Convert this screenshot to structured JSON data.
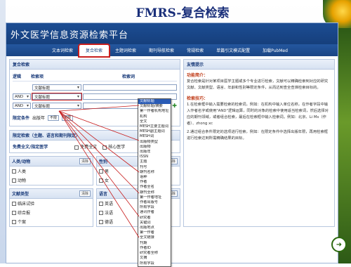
{
  "slide_title": "FMRS-复合检索",
  "app_title": "外文医学信息资源检索平台",
  "nav": [
    "文本词检索",
    "复合检索",
    "主题词检索",
    "期刊导航检索",
    "常规检索",
    "单篇引文模式配置",
    "加载PubMed"
  ],
  "left": {
    "section_title": "复合检索",
    "grid_headers": [
      "逻辑",
      "检索项",
      "检索词"
    ],
    "rows": [
      {
        "logic": "",
        "field": "文献标题"
      },
      {
        "logic": "AND",
        "field": "文献标题"
      },
      {
        "logic": "AND",
        "field": "文献标题"
      }
    ],
    "limit_label": "限定条件",
    "limit_year_label": "出版年",
    "limit_year_from": "不限",
    "limit_year_to": "不限",
    "sub_section": "限定检索（主题、语言和期刊限定）",
    "options_label": "免费全文/指定医学",
    "opt_fulltext": "免费全文",
    "opt_core": "核心医学",
    "cards_row1": [
      {
        "title": "人类/动物",
        "btn": "清除",
        "items": [
          "人类",
          "动物"
        ]
      },
      {
        "title": "性别",
        "btn": "清除",
        "items": [
          "男",
          "女"
        ]
      }
    ],
    "cards_row2": [
      {
        "title": "文献类型",
        "btn": "清除",
        "items": [
          "临床试验",
          "综合报",
          "个案"
        ]
      },
      {
        "title": "语言",
        "btn": "清除",
        "items": [
          "英语",
          "法语",
          "德语"
        ]
      }
    ]
  },
  "right": {
    "title": "友情提示",
    "h1": "功能简介：",
    "p1": "复合检索是针对某项目医学主题或多个专业进行检索，文献可以精确检索到对应的研究文献、文献类型、语言、年龄和性别等限定条件，从而达到查全查准检索目标的。",
    "h2": "检索技巧：",
    "p2": "1.在检索框中输入需要检索的检索词，例如：在机构中输入单位名称，在作者字段中输入作者名字或使用\"AND\"逻辑运算，同时的对象的检索中使用适当检索词，然后选择对应的期刊领域，或者组合检索，最后在检索框中输入检索词。例如：北京、Li Ms（作者）、zhong xc",
    "p3": "2.通过组合条件限定的选项进行检索，例如：在限定条件中选择出版年限，再用检索框进行检索达到所需精确结果的目标。"
  },
  "dropdown_options": [
    "文献标题",
    "文献标题/摘要",
    "第一作者机构地址",
    "机构",
    "全文",
    "MESH主要主题词",
    "MESH副主题词",
    "MESH词",
    "出版物类型",
    "出版物",
    "出版年",
    "ISSN",
    "主题",
    "刊号",
    "期刊名称",
    "语种",
    "作者",
    "作者全名",
    "期刊全称",
    "第一作者地址",
    "作者出版号",
    "所有字段",
    "通讯作者",
    "研究者",
    "关键词",
    "出版地点",
    "第一作者",
    "全文链接",
    "刊期",
    "作者ID",
    "研究者全称",
    "文摘",
    "所有字段"
  ]
}
